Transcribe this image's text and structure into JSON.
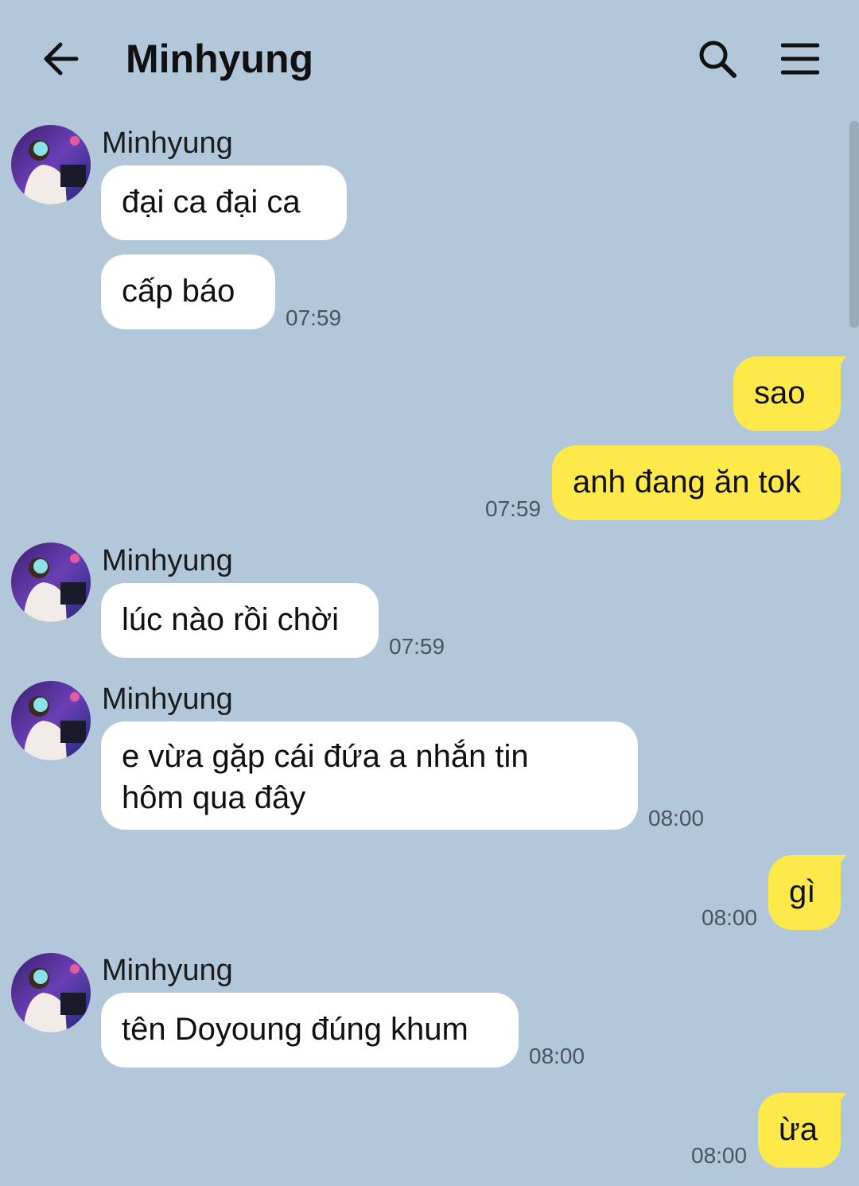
{
  "header": {
    "title": "Minhyung",
    "back_icon": "arrow-left-icon",
    "search_icon": "search-icon",
    "menu_icon": "hamburger-menu-icon"
  },
  "colors": {
    "background": "#b2c7da",
    "incoming_bubble": "#ffffff",
    "outgoing_bubble": "#fee94a"
  },
  "messages": [
    {
      "direction": "incoming",
      "sender": "Minhyung",
      "text": "đại ca đại ca",
      "time": ""
    },
    {
      "direction": "incoming",
      "sender": "",
      "text": "cấp báo",
      "time": "07:59"
    },
    {
      "direction": "outgoing",
      "text": "sao",
      "time": ""
    },
    {
      "direction": "outgoing",
      "text": "anh đang ăn tok",
      "time": "07:59"
    },
    {
      "direction": "incoming",
      "sender": "Minhyung",
      "text": "lúc nào rồi chời",
      "time": "07:59"
    },
    {
      "direction": "incoming",
      "sender": "Minhyung",
      "text": "e vừa gặp cái đứa a nhắn tin",
      "text_line2": "hôm qua đây",
      "time": "08:00"
    },
    {
      "direction": "outgoing",
      "text": "gì",
      "time": "08:00"
    },
    {
      "direction": "incoming",
      "sender": "Minhyung",
      "text": "tên Doyoung đúng khum",
      "time": "08:00"
    },
    {
      "direction": "outgoing",
      "text": "ừa",
      "time": "08:00"
    }
  ]
}
